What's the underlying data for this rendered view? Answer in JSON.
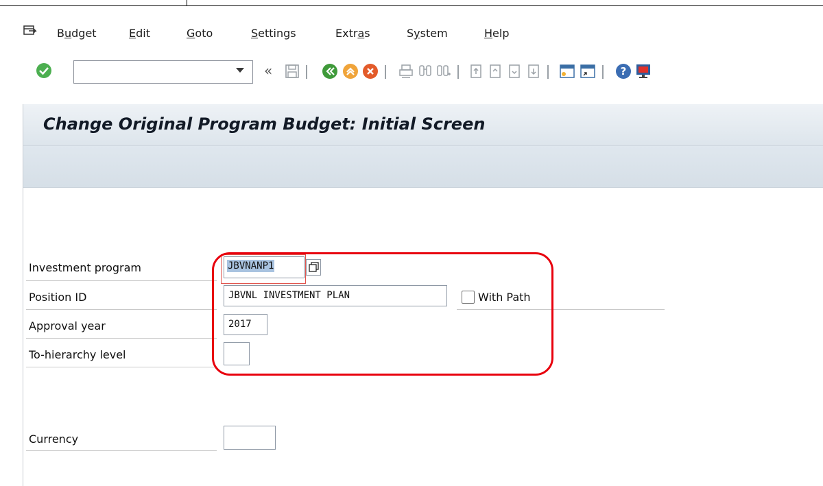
{
  "menu": {
    "items": [
      {
        "label_pre": "B",
        "label_ul": "u",
        "label_post": "dget"
      },
      {
        "label_pre": "",
        "label_ul": "E",
        "label_post": "dit"
      },
      {
        "label_pre": "",
        "label_ul": "G",
        "label_post": "oto"
      },
      {
        "label_pre": "",
        "label_ul": "S",
        "label_post": "ettings"
      },
      {
        "label_pre": "Extr",
        "label_ul": "a",
        "label_post": "s"
      },
      {
        "label_pre": "S",
        "label_ul": "y",
        "label_post": "stem"
      },
      {
        "label_pre": "",
        "label_ul": "H",
        "label_post": "elp"
      }
    ]
  },
  "toolbar": {
    "command_field_value": "",
    "collapse_glyph": "«"
  },
  "screen": {
    "title": "Change Original Program Budget: Initial Screen"
  },
  "form": {
    "investment_program_label": "Investment program",
    "investment_program_value": "JBVNANP1",
    "position_id_label": "Position ID",
    "position_id_value": "JBVNL INVESTMENT PLAN",
    "with_path_label": "With Path",
    "with_path_checked": false,
    "approval_year_label": "Approval year",
    "approval_year_value": "2017",
    "to_hierarchy_label": "To-hierarchy level",
    "to_hierarchy_value": "",
    "currency_label": "Currency",
    "currency_value": ""
  },
  "colors": {
    "annotation_red": "#e8000d",
    "title_bg": "#dde5ec"
  }
}
